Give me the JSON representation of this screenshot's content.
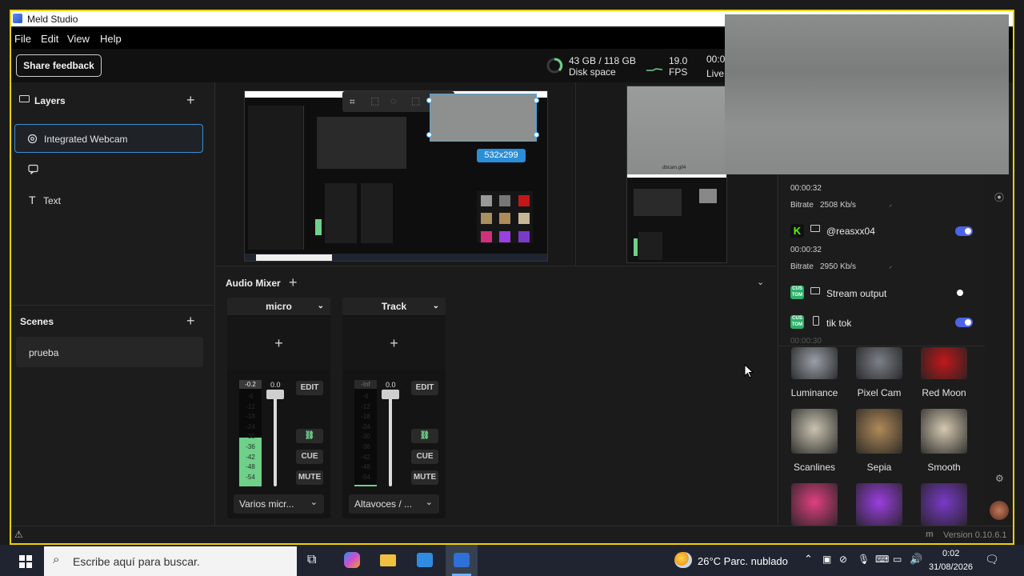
{
  "window": {
    "title": "Meld Studio"
  },
  "menu": [
    "File",
    "Edit",
    "View",
    "Help"
  ],
  "topbar": {
    "feedback_label": "Share feedback",
    "disk_value": "43 GB / 118 GB",
    "disk_label": "Disk space",
    "fps_value": "19.0",
    "fps_label": "FPS",
    "live_time": "00:0",
    "live_label": "Live"
  },
  "layers": {
    "title": "Layers",
    "items": [
      {
        "label": "Integrated Webcam",
        "icon": "webcam-icon"
      },
      {
        "label": "",
        "icon": "chat-icon"
      },
      {
        "label": "Text",
        "icon": "text-icon"
      }
    ]
  },
  "scenes": {
    "title": "Scenes",
    "items": [
      "prueba"
    ]
  },
  "preview": {
    "size_badge": "532x299",
    "cam_label": "dbcam.gif4"
  },
  "mixer": {
    "title": "Audio Mixer",
    "tracks": [
      {
        "name": "micro",
        "peak": "-0.2",
        "volume": "0.0",
        "device": "Varios micr...",
        "edit": "EDIT",
        "cue": "CUE",
        "mute": "MUTE",
        "meter_level": 0.5,
        "scale": [
          "-6",
          "-12",
          "-18",
          "-24",
          "-30",
          "-36",
          "-42",
          "-48",
          "-54"
        ]
      },
      {
        "name": "Track",
        "peak": "-Inf",
        "volume": "0.0",
        "device": "Altavoces / ...",
        "edit": "EDIT",
        "cue": "CUE",
        "mute": "MUTE",
        "meter_level": 0.02,
        "scale": [
          "-6",
          "-12",
          "-18",
          "-24",
          "-30",
          "-36",
          "-42",
          "-48",
          "-54"
        ]
      }
    ]
  },
  "streams": {
    "first": {
      "time": "00:00:32",
      "bitrate_label": "Bitrate",
      "bitrate": "2508 Kb/s"
    },
    "items": [
      {
        "name": "@reasxx04",
        "time": "00:00:32",
        "bitrate_label": "Bitrate",
        "bitrate": "2950 Kb/s",
        "enabled": true,
        "platform": "kick"
      },
      {
        "name": "Stream output",
        "enabled": false,
        "platform": "custom"
      },
      {
        "name": "tik tok",
        "enabled": true,
        "platform": "custom",
        "time": "00:00:30"
      }
    ],
    "custom_badge": "CUS TOM"
  },
  "effects": [
    {
      "label": "Luminance",
      "color": "#9aa0a8"
    },
    {
      "label": "Pixel Cam",
      "color": "#7c8088"
    },
    {
      "label": "Red Moon",
      "color": "#c2181a"
    },
    {
      "label": "Scanlines",
      "color": "#c9c3b0"
    },
    {
      "label": "Sepia",
      "color": "#b08a5a"
    },
    {
      "label": "Smooth",
      "color": "#d4c8b0"
    },
    {
      "label": "",
      "color": "#e04080"
    },
    {
      "label": "",
      "color": "#9b3fe0"
    },
    {
      "label": "",
      "color": "#7a3ac8"
    }
  ],
  "status": {
    "version": "Version 0.10.6.1"
  },
  "taskbar": {
    "search_placeholder": "Escribe aquí para buscar.",
    "weather": "26°C  Parc. nublado",
    "time": "0:02",
    "date": "31/08/2026"
  },
  "colors": {
    "accent": "#3b8fd6",
    "toggle_on": "#4a64e8",
    "meter": "#6fd08a",
    "kick": "#53fc18",
    "custom": "#2db06a"
  }
}
